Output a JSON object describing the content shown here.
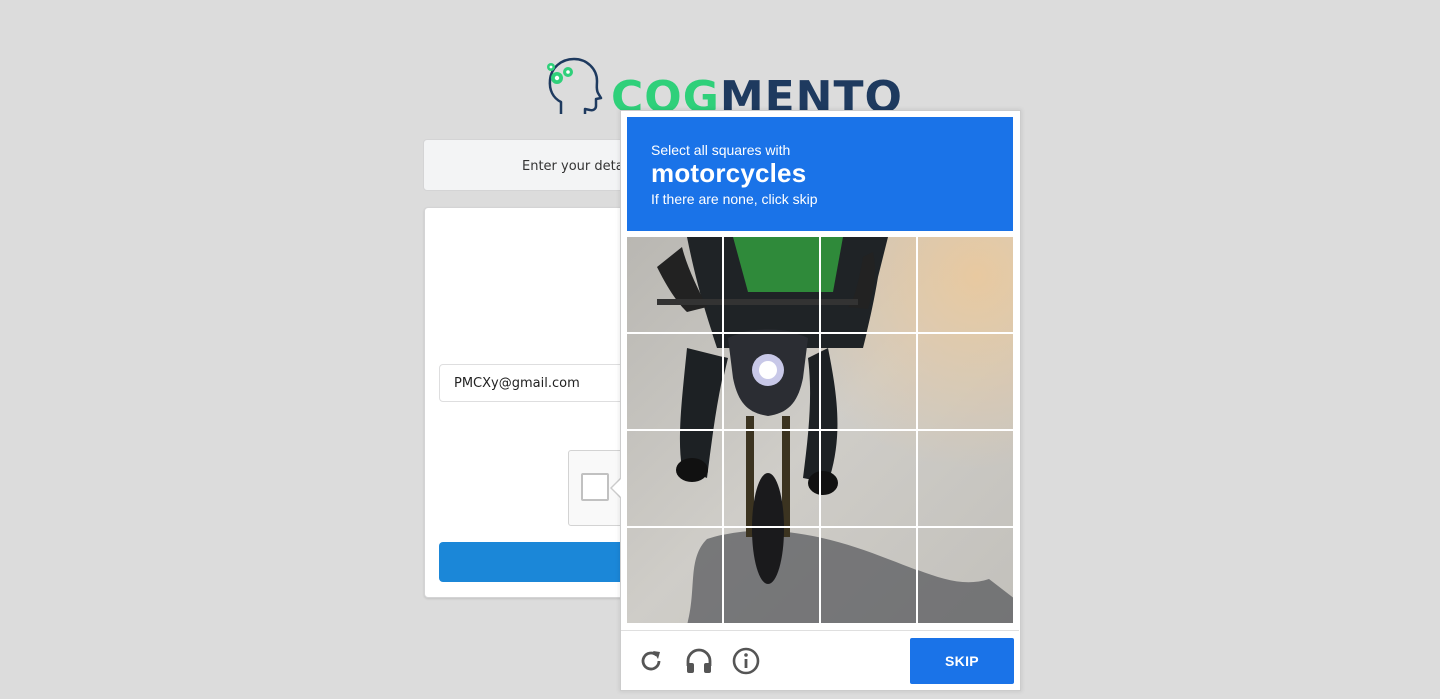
{
  "logo": {
    "part1": "COG",
    "part2": "MENTO",
    "icon": "head-with-gears-icon"
  },
  "details_bar": {
    "text": "Enter your details"
  },
  "login": {
    "email_value": "PMCXy@gmail.com"
  },
  "captcha": {
    "prompt_line1": "Select all squares with",
    "target": "motorcycles",
    "prompt_line3": "If there are none, click skip",
    "skip_label": "SKIP",
    "icons": [
      "reload-icon",
      "audio-headphones-icon",
      "info-icon"
    ],
    "tile_count": 16
  },
  "colors": {
    "background": "#dcdcdc",
    "captcha_blue": "#1a73e8",
    "login_button": "#1b87d8",
    "logo_green": "#2fd07a",
    "logo_navy": "#1e3a5f"
  }
}
